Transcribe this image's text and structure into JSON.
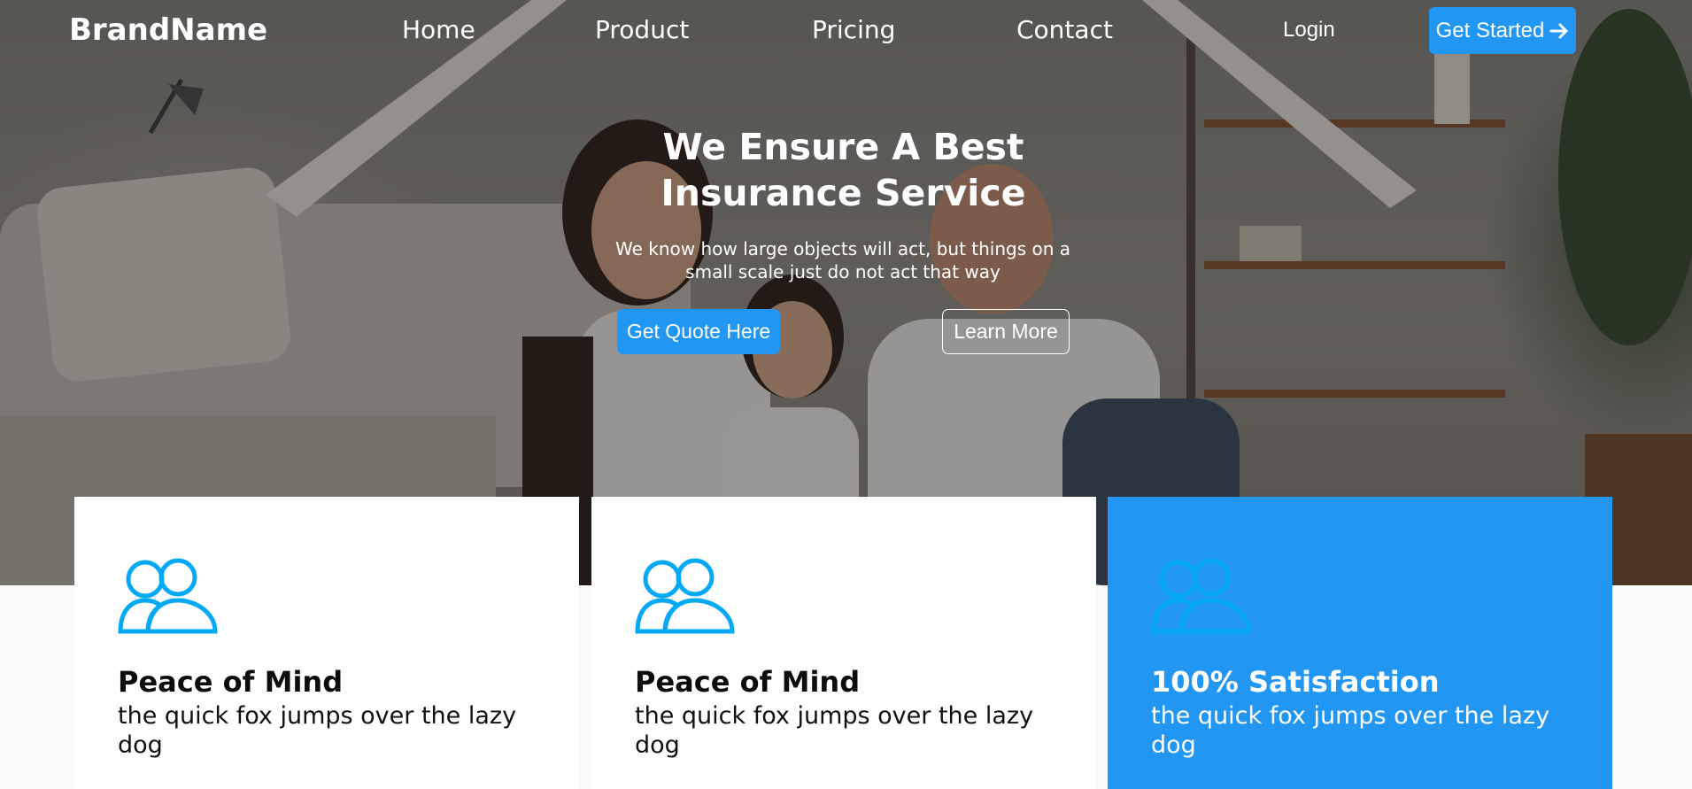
{
  "nav": {
    "brand": "BrandName",
    "links": [
      "Home",
      "Product",
      "Pricing",
      "Contact"
    ],
    "login": "Login",
    "cta": "Get Started"
  },
  "hero": {
    "title": "We Ensure A Best Insurance Service",
    "subtitle": "We know how large objects will act, but things on a small scale just do not act that way",
    "primary_button": "Get Quote Here",
    "secondary_button": "Learn More"
  },
  "features": [
    {
      "title": "Peace of Mind",
      "text": "the quick fox jumps over the lazy dog",
      "icon": "users-icon"
    },
    {
      "title": "Peace of Mind",
      "text": "the quick fox jumps over the lazy dog",
      "icon": "users-icon"
    },
    {
      "title": "100% Satisfaction",
      "text": "the quick fox jumps over the lazy dog",
      "icon": "users-icon"
    }
  ],
  "colors": {
    "accent": "#2196f3",
    "icon": "#03a9f4",
    "card_active_bg": "#2196f3"
  }
}
